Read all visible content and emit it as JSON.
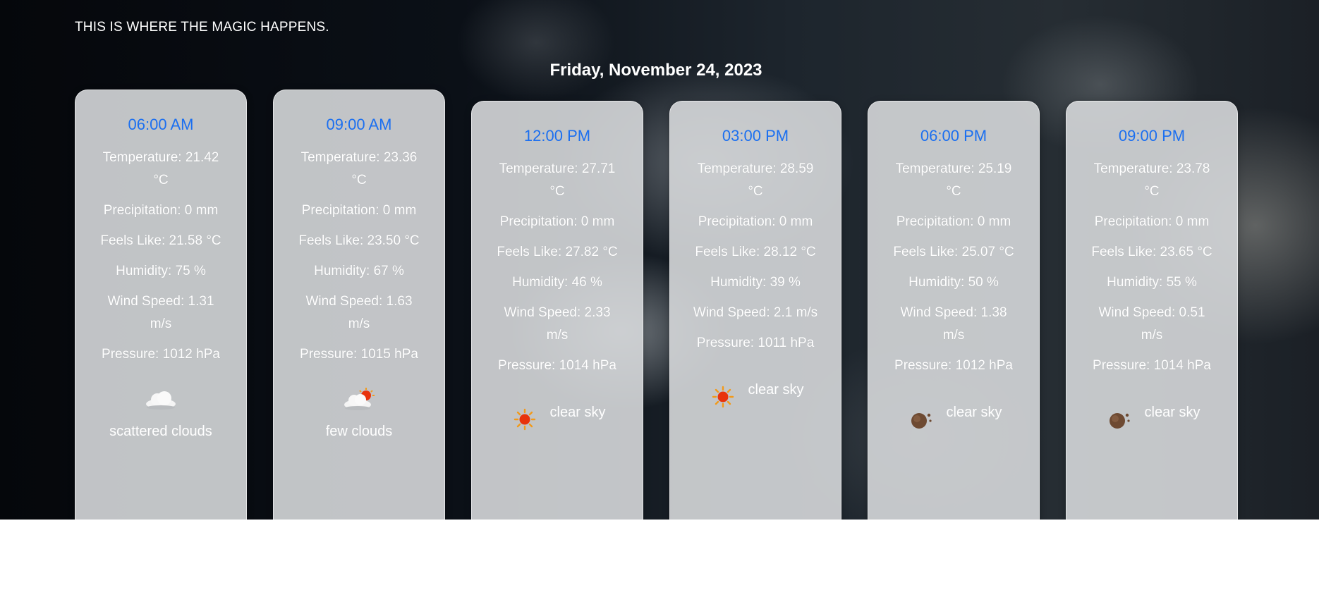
{
  "header": {
    "tagline": "THIS IS WHERE THE MAGIC HAPPENS.",
    "date": "Friday, November 24, 2023"
  },
  "colors": {
    "time_text": "#1b6ff0",
    "card_bg": "#d6d8da",
    "sun": "#e8330c",
    "moon": "#6e4a32"
  },
  "forecast": [
    {
      "time": "06:00 AM",
      "temperature": "Temperature: 21.42 °C",
      "precipitation": "Precipitation: 0 mm",
      "feels_like": "Feels Like: 21.58 °C",
      "humidity": "Humidity: 75 %",
      "wind_speed": "Wind Speed: 1.31 m/s",
      "pressure": "Pressure: 1012 hPa",
      "icon": "scattered-clouds-icon",
      "description": "scattered clouds"
    },
    {
      "time": "09:00 AM",
      "temperature": "Temperature: 23.36 °C",
      "precipitation": "Precipitation: 0 mm",
      "feels_like": "Feels Like: 23.50 °C",
      "humidity": "Humidity: 67 %",
      "wind_speed": "Wind Speed: 1.63 m/s",
      "pressure": "Pressure: 1015 hPa",
      "icon": "few-clouds-icon",
      "description": "few clouds"
    },
    {
      "time": "12:00 PM",
      "temperature": "Temperature: 27.71 °C",
      "precipitation": "Precipitation: 0 mm",
      "feels_like": "Feels Like: 27.82 °C",
      "humidity": "Humidity: 46 %",
      "wind_speed": "Wind Speed: 2.33 m/s",
      "pressure": "Pressure: 1014 hPa",
      "icon": "sun-icon",
      "description": "clear sky"
    },
    {
      "time": "03:00 PM",
      "temperature": "Temperature: 28.59 °C",
      "precipitation": "Precipitation: 0 mm",
      "feels_like": "Feels Like: 28.12 °C",
      "humidity": "Humidity: 39 %",
      "wind_speed": "Wind Speed: 2.1 m/s",
      "pressure": "Pressure: 1011 hPa",
      "icon": "sun-icon",
      "description": "clear sky"
    },
    {
      "time": "06:00 PM",
      "temperature": "Temperature: 25.19 °C",
      "precipitation": "Precipitation: 0 mm",
      "feels_like": "Feels Like: 25.07 °C",
      "humidity": "Humidity: 50 %",
      "wind_speed": "Wind Speed: 1.38 m/s",
      "pressure": "Pressure: 1012 hPa",
      "icon": "moon-icon",
      "description": "clear sky"
    },
    {
      "time": "09:00 PM",
      "temperature": "Temperature: 23.78 °C",
      "precipitation": "Precipitation: 0 mm",
      "feels_like": "Feels Like: 23.65 °C",
      "humidity": "Humidity: 55 %",
      "wind_speed": "Wind Speed: 0.51 m/s",
      "pressure": "Pressure: 1014 hPa",
      "icon": "moon-icon",
      "description": "clear sky"
    }
  ]
}
